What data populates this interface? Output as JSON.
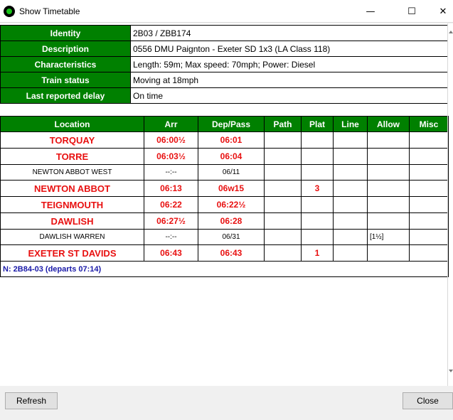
{
  "window": {
    "title": "Show Timetable",
    "min_glyph": "—",
    "max_glyph": "☐",
    "close_glyph": "✕"
  },
  "info": [
    {
      "label": "Identity",
      "value": "2B03 / ZBB174"
    },
    {
      "label": "Description",
      "value": "0556 DMU Paignton - Exeter SD 1x3 (LA Class 118)"
    },
    {
      "label": "Characteristics",
      "value": "Length: 59m; Max speed: 70mph; Power: Diesel"
    },
    {
      "label": "Train status",
      "value": "Moving at 18mph"
    },
    {
      "label": "Last reported delay",
      "value": "On time"
    }
  ],
  "timetable": {
    "columns": [
      "Location",
      "Arr",
      "Dep/Pass",
      "Path",
      "Plat",
      "Line",
      "Allow",
      "Misc"
    ],
    "rows": [
      {
        "location": "TORQUAY",
        "arr": "06:00½",
        "dep": "06:01",
        "path": "",
        "plat": "",
        "line": "",
        "allow": "",
        "misc": ""
      },
      {
        "location": "TORRE",
        "arr": "06:03½",
        "dep": "06:04",
        "path": "",
        "plat": "",
        "line": "",
        "allow": "",
        "misc": ""
      },
      {
        "location": "NEWTON ABBOT WEST",
        "arr": "--:--",
        "dep": "06/11",
        "path": "",
        "plat": "",
        "line": "",
        "allow": "",
        "misc": ""
      },
      {
        "location": "NEWTON ABBOT",
        "arr": "06:13",
        "dep": "06w15",
        "path": "",
        "plat": "3",
        "line": "",
        "allow": "",
        "misc": ""
      },
      {
        "location": "TEIGNMOUTH",
        "arr": "06:22",
        "dep": "06:22½",
        "path": "",
        "plat": "",
        "line": "",
        "allow": "",
        "misc": ""
      },
      {
        "location": "DAWLISH",
        "arr": "06:27½",
        "dep": "06:28",
        "path": "",
        "plat": "",
        "line": "",
        "allow": "",
        "misc": ""
      },
      {
        "location": "DAWLISH WARREN",
        "arr": "--:--",
        "dep": "06/31",
        "path": "",
        "plat": "",
        "line": "",
        "allow": "[1½]",
        "misc": ""
      },
      {
        "location": "EXETER ST DAVIDS",
        "arr": "06:43",
        "dep": "06:43",
        "path": "",
        "plat": "1",
        "line": "",
        "allow": "",
        "misc": ""
      }
    ],
    "next_working": "N: 2B84-03 (departs 07:14)"
  },
  "buttons": {
    "refresh": "Refresh",
    "close": "Close"
  },
  "colors": {
    "header_green": "#008000",
    "station_red": "#e81010",
    "next_blue": "#1a1aa8"
  }
}
